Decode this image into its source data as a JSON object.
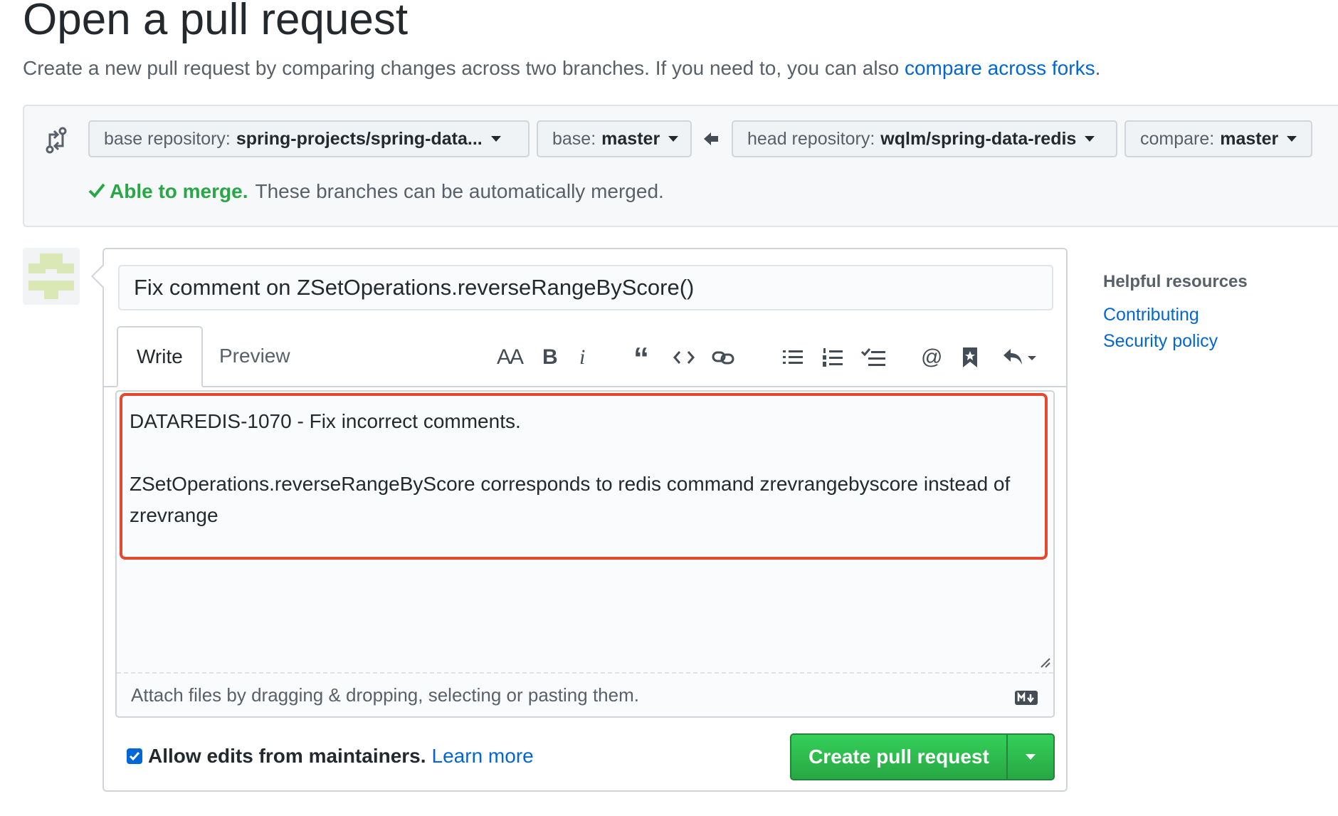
{
  "page": {
    "title": "Open a pull request",
    "subtitle_text": "Create a new pull request by comparing changes across two branches. If you need to, you can also ",
    "subtitle_link": "compare across forks",
    "subtitle_end": "."
  },
  "range": {
    "base_repo_label": "base repository:",
    "base_repo_value": "spring-projects/spring-data...",
    "base_label": "base:",
    "base_value": "master",
    "head_repo_label": "head repository:",
    "head_repo_value": "wqlm/spring-data-redis",
    "compare_label": "compare:",
    "compare_value": "master",
    "merge_ok": "Able to merge.",
    "merge_text": "These branches can be automatically merged."
  },
  "form": {
    "title_value": "Fix comment on ZSetOperations.reverseRangeByScore()",
    "tab_write": "Write",
    "tab_preview": "Preview",
    "toolbar": {
      "heading": "AA",
      "bold": "B",
      "italic": "i",
      "quote": "“",
      "mention": "@"
    },
    "body": "DATAREDIS-1070 - Fix incorrect comments.\n\nZSetOperations.reverseRangeByScore corresponds to redis command zrevrangebyscore instead of zrevrange",
    "attach_text": "Attach files by dragging & dropping, selecting or pasting them.",
    "allow_edits": "Allow edits from maintainers.",
    "learn_more": "Learn more",
    "create_button": "Create pull request"
  },
  "sidebar": {
    "title": "Helpful resources",
    "links": [
      "Contributing",
      "Security policy"
    ]
  },
  "colors": {
    "accent": "#0366d6",
    "success": "#28a745",
    "highlight": "#e5482f"
  }
}
